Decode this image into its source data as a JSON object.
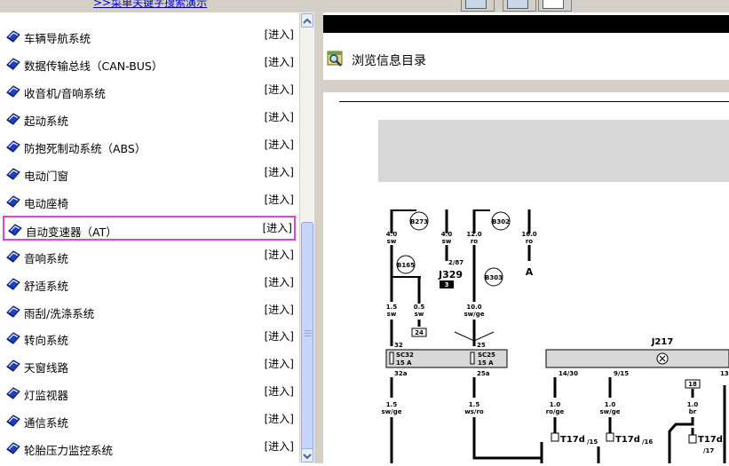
{
  "top": {
    "link_text": ">>菜单关键字搜索演示"
  },
  "menu": {
    "items": [
      {
        "label": "车辆导航系统",
        "enter": "[进入]"
      },
      {
        "label": "数据传输总线（CAN-BUS）",
        "enter": "[进入]"
      },
      {
        "label": "收音机/音响系统",
        "enter": "[进入]"
      },
      {
        "label": "起动系统",
        "enter": "[进入]"
      },
      {
        "label": "防抱死制动系统（ABS）",
        "enter": "[进入]"
      },
      {
        "label": "电动门窗",
        "enter": "[进入]"
      },
      {
        "label": "电动座椅",
        "enter": "[进入]"
      },
      {
        "label": "自动变速器（AT）",
        "enter": "[进入]",
        "selected": true
      },
      {
        "label": "音响系统",
        "enter": "[进入]"
      },
      {
        "label": "舒适系统",
        "enter": "[进入]"
      },
      {
        "label": "雨刮/洗涤系统",
        "enter": "[进入]"
      },
      {
        "label": "转向系统",
        "enter": "[进入]"
      },
      {
        "label": "天窗线路",
        "enter": "[进入]"
      },
      {
        "label": "灯监视器",
        "enter": "[进入]"
      },
      {
        "label": "通信系统",
        "enter": "[进入]"
      },
      {
        "label": "轮胎压力监控系统",
        "enter": "[进入]"
      }
    ]
  },
  "content": {
    "browse_label": "浏览信息目录"
  },
  "diagram": {
    "fuse_labels": [
      "B273",
      "B302",
      "B165",
      "B303"
    ],
    "relay_ref": "J329",
    "relay_pin": "2/87",
    "relay_slot": "3",
    "ground_mark": "A",
    "wires_top": [
      {
        "size": "4.0",
        "color": "sw"
      },
      {
        "size": "4.0",
        "color": "sw"
      },
      {
        "size": "12.0",
        "color": "ro"
      },
      {
        "size": "16.0",
        "color": "ro"
      }
    ],
    "wires_mid": [
      {
        "size": "1.5",
        "color": "sw"
      },
      {
        "size": "0.5",
        "color": "sw"
      },
      {
        "size": "10.0",
        "color": "sw/ge"
      }
    ],
    "pin_24": "24",
    "fuses": [
      {
        "name": "SC32",
        "rating": "15 A",
        "pin_in": "32",
        "pin_out": "32a"
      },
      {
        "name": "SC25",
        "rating": "15 A",
        "pin_in": "25",
        "pin_out": "25a"
      }
    ],
    "module": {
      "name": "J217",
      "pins": [
        "14/30",
        "9/15",
        "13"
      ],
      "pin_box": "18"
    },
    "wires_bottom": [
      {
        "size": "1.5",
        "color": "sw/ge"
      },
      {
        "size": "1.5",
        "color": "ws/ro"
      },
      {
        "size": "1.0",
        "color": "ro/ge"
      },
      {
        "size": "1.0",
        "color": "sw/ge"
      },
      {
        "size": "1.0",
        "color": "br"
      }
    ],
    "connectors": [
      {
        "name": "T17d",
        "pin": "/15"
      },
      {
        "name": "T17d",
        "pin": "/16"
      },
      {
        "name": "T17d",
        "pin": "/17"
      }
    ]
  }
}
